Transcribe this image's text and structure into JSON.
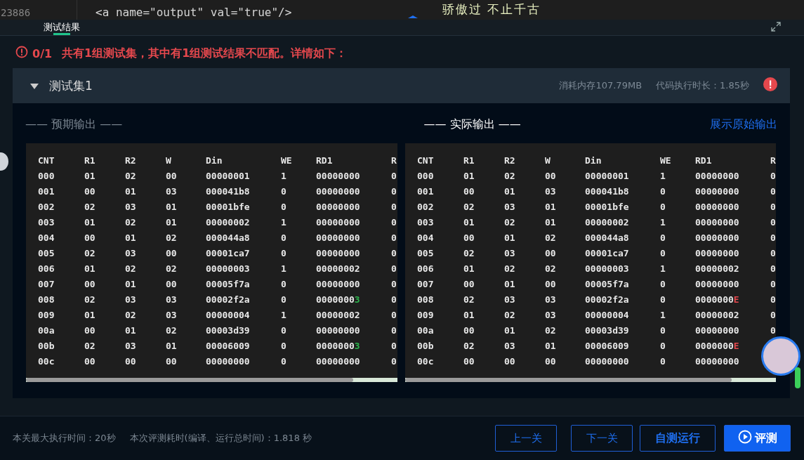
{
  "editor": {
    "line_number": "23886",
    "code": "<a name=\"output\" val=\"true\"/>",
    "banner_text": "骄傲过 不止千古"
  },
  "panel": {
    "tabs": [
      {
        "label": "测试结果",
        "selected": true
      }
    ]
  },
  "summary": {
    "score": "0/1",
    "message": "共有1组测试集，其中有1组测试结果不匹配。详情如下："
  },
  "test_set": {
    "title": "测试集1",
    "expanded": true,
    "memory": "消耗内存107.79MB",
    "duration": "代码执行时长：1.85秒",
    "failed": true,
    "expected_title": "—— 预期输出 ——",
    "actual_title": "—— 实际输出 ——",
    "raw_link": "展示原始输出",
    "outputs": [
      {
        "kind": "expected",
        "columns": [
          "CNT",
          "R1",
          "R2",
          "W",
          "Din",
          "WE",
          "RD1",
          "R"
        ],
        "rows": [
          [
            "000",
            "01",
            "02",
            "00",
            "00000001",
            "1",
            "00000000",
            "0"
          ],
          [
            "001",
            "00",
            "01",
            "03",
            "000041b8",
            "0",
            "00000000",
            "0"
          ],
          [
            "002",
            "02",
            "03",
            "01",
            "00001bfe",
            "0",
            "00000000",
            "0"
          ],
          [
            "003",
            "01",
            "02",
            "01",
            "00000002",
            "1",
            "00000000",
            "0"
          ],
          [
            "004",
            "00",
            "01",
            "02",
            "000044a8",
            "0",
            "00000000",
            "0"
          ],
          [
            "005",
            "02",
            "03",
            "00",
            "00001ca7",
            "0",
            "00000000",
            "0"
          ],
          [
            "006",
            "01",
            "02",
            "02",
            "00000003",
            "1",
            "00000002",
            "0"
          ],
          [
            "007",
            "00",
            "01",
            "00",
            "00005f7a",
            "0",
            "00000000",
            "0"
          ],
          [
            "008",
            "02",
            "03",
            "03",
            "00002f2a",
            "0",
            {
              "text": "0000000",
              "diff": "3"
            },
            "0"
          ],
          [
            "009",
            "01",
            "02",
            "03",
            "00000004",
            "1",
            "00000002",
            "0"
          ],
          [
            "00a",
            "00",
            "01",
            "02",
            "00003d39",
            "0",
            "00000000",
            "0"
          ],
          [
            "00b",
            "02",
            "03",
            "01",
            "00006009",
            "0",
            {
              "text": "0000000",
              "diff": "3"
            },
            "0"
          ],
          [
            "00c",
            "00",
            "00",
            "00",
            "00000000",
            "0",
            "00000000",
            "0"
          ]
        ]
      },
      {
        "kind": "actual",
        "columns": [
          "CNT",
          "R1",
          "R2",
          "W",
          "Din",
          "WE",
          "RD1",
          "R"
        ],
        "rows": [
          [
            "000",
            "01",
            "02",
            "00",
            "00000001",
            "1",
            "00000000",
            "0"
          ],
          [
            "001",
            "00",
            "01",
            "03",
            "000041b8",
            "0",
            "00000000",
            "0"
          ],
          [
            "002",
            "02",
            "03",
            "01",
            "00001bfe",
            "0",
            "00000000",
            "0"
          ],
          [
            "003",
            "01",
            "02",
            "01",
            "00000002",
            "1",
            "00000000",
            "0"
          ],
          [
            "004",
            "00",
            "01",
            "02",
            "000044a8",
            "0",
            "00000000",
            "0"
          ],
          [
            "005",
            "02",
            "03",
            "00",
            "00001ca7",
            "0",
            "00000000",
            "0"
          ],
          [
            "006",
            "01",
            "02",
            "02",
            "00000003",
            "1",
            "00000002",
            "0"
          ],
          [
            "007",
            "00",
            "01",
            "00",
            "00005f7a",
            "0",
            "00000000",
            "0"
          ],
          [
            "008",
            "02",
            "03",
            "03",
            "00002f2a",
            "0",
            {
              "text": "0000000",
              "diff": "E"
            },
            "0"
          ],
          [
            "009",
            "01",
            "02",
            "03",
            "00000004",
            "1",
            "00000002",
            "0"
          ],
          [
            "00a",
            "00",
            "01",
            "02",
            "00003d39",
            "0",
            "00000000",
            "0"
          ],
          [
            "00b",
            "02",
            "03",
            "01",
            "00006009",
            "0",
            {
              "text": "0000000",
              "diff": "E"
            }
          ],
          [
            "00c",
            "00",
            "00",
            "00",
            "00000000",
            "0",
            "00000000"
          ]
        ]
      }
    ]
  },
  "footer": {
    "max_time": "本关最大执行时间：20秒",
    "eval_time": "本次评测耗时(编译、运行总时间)：1.818 秒",
    "buttons": [
      {
        "kind": "outline",
        "label": "上一关"
      },
      {
        "kind": "outline",
        "label": "下一关"
      },
      {
        "kind": "strong",
        "label": "自测运行"
      },
      {
        "kind": "primary",
        "label": "评测"
      }
    ]
  }
}
